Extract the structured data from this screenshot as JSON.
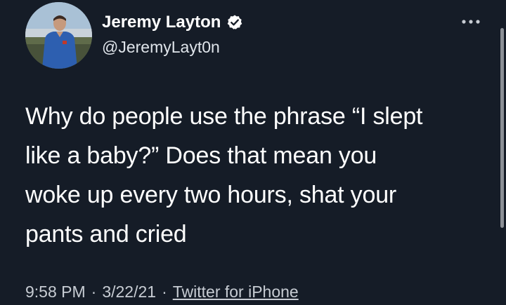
{
  "tweet": {
    "author": {
      "display_name": "Jeremy Layton",
      "handle": "@JeremyLayt0n",
      "verified": true,
      "avatar_icon": "profile-photo"
    },
    "text": "Why do people use the phrase “I slept like a baby?” Does that mean you woke up every two hours, shat your pants and cried",
    "time": "9:58 PM",
    "separator": "·",
    "date": "3/22/21",
    "source": "Twitter for iPhone",
    "more_icon": "more-options-icon",
    "colors": {
      "background": "#151c27",
      "text": "#ffffff",
      "secondary": "#c7ccd3"
    }
  }
}
